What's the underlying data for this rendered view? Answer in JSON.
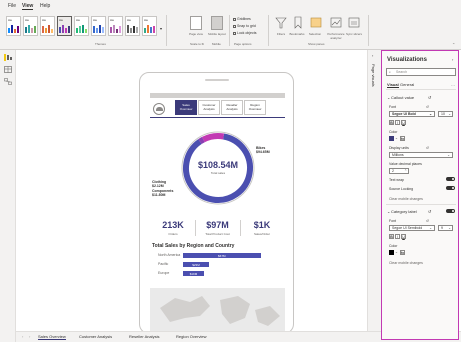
{
  "menu": {
    "file": "File",
    "view": "View",
    "help": "Help"
  },
  "ribbon": {
    "theme_sample_text": "Aa",
    "themes_label": "Themes",
    "page_view_label": "Page view",
    "mobile_layout_label": "Mobile layout",
    "gridlines": "Gridlines",
    "snap_to_grid": "Snap to grid",
    "lock_objects": "Lock objects",
    "scale_to_fit_label": "Scale to fit",
    "mobile_label": "Mobile",
    "page_options_label": "Page options",
    "filters_label": "Filters",
    "bookmarks_label": "Bookmarks",
    "selection_label": "Selection",
    "performance_label": "Performance analyzer",
    "sync_slicers_label": "Sync slicers",
    "show_panes_label": "Show panes"
  },
  "report": {
    "nav": [
      "Sales Overview",
      "Customer Analysis",
      "Reseller Analysis",
      "Region Overview"
    ],
    "donut_total": "$108.54M",
    "donut_total_caption": "Total sales",
    "donut_labels": [
      {
        "text": "Bikes",
        "value": "$94.65M"
      },
      {
        "text": "Clothing",
        "value": "$2.12M"
      },
      {
        "text": "Components",
        "value": "$11.80M"
      }
    ],
    "kpis": [
      {
        "value": "213K",
        "caption": "Orders"
      },
      {
        "value": "$97M",
        "caption": "Total Product Cost"
      },
      {
        "value": "$1K",
        "caption": "Sales/Order"
      }
    ],
    "region_title": "Total Sales by Region and Country",
    "regions": [
      {
        "label": "North America",
        "value": "$67M",
        "share": 0.62
      },
      {
        "label": "Pacific",
        "value": "$23M",
        "share": 0.21
      },
      {
        "label": "Europe",
        "value": "$19M",
        "share": 0.17
      }
    ]
  },
  "page_tabs": [
    "Sales Overview",
    "Customer Analysis",
    "Reseller Analysis",
    "Region Overview"
  ],
  "page_visuals_label": "Page visuals",
  "viz": {
    "title": "Visualizations",
    "search_placeholder": "Search",
    "tab_visual": "Visual",
    "tab_general": "General",
    "callout_section": "Callout value",
    "font_label": "Font",
    "font_value": "Segoe UI Bold",
    "font_size": "10",
    "color_label": "Color",
    "display_units_label": "Display units",
    "display_units_value": "Millions",
    "decimal_label": "Value decimal places",
    "decimal_value": "2",
    "text_wrap_label": "Text wrap",
    "source_locking_label": "Source Locking",
    "clear_changes": "Clear mobile changes",
    "category_section": "Category label",
    "font2_value": "Segoe UI Semibold",
    "font2_size": "9",
    "clear_changes2": "Clear mobile changes"
  },
  "colors": {
    "accent": "#3b3a7a",
    "bar": "#4b4fb0",
    "pane_border": "#c239b3"
  }
}
